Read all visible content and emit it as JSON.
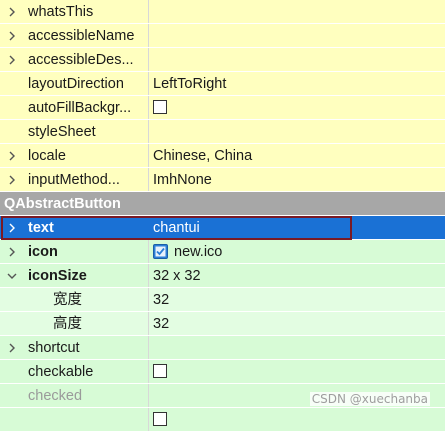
{
  "colors": {
    "row_yellow": "#ffffbf",
    "row_green": "#d7fbd6",
    "section_header": "#a7a7a7",
    "selection": "#1a71d5",
    "focus_border": "#7a1a25"
  },
  "properties_top": [
    {
      "name": "whatsThis",
      "value": "",
      "expandable": true
    },
    {
      "name": "accessibleName",
      "value": "",
      "expandable": true
    },
    {
      "name": "accessibleDes...",
      "value": "",
      "expandable": true
    },
    {
      "name": "layoutDirection",
      "value": "LeftToRight",
      "expandable": false
    },
    {
      "name": "autoFillBackgr...",
      "value": "",
      "checkbox": true,
      "expandable": false
    },
    {
      "name": "styleSheet",
      "value": "",
      "expandable": false
    },
    {
      "name": "locale",
      "value": "Chinese, China",
      "expandable": true
    },
    {
      "name": "inputMethod...",
      "value": "ImhNone",
      "expandable": true
    }
  ],
  "section": {
    "title": "QAbstractButton"
  },
  "text_row": {
    "name": "text",
    "value": "chantui"
  },
  "icon_row": {
    "name": "icon",
    "value": "new.ico",
    "icon": "check-image-icon"
  },
  "iconsize_row": {
    "name": "iconSize",
    "value": "32 x 32"
  },
  "width_row": {
    "name": "宽度",
    "value": "32"
  },
  "height_row": {
    "name": "高度",
    "value": "32"
  },
  "shortcut_row": {
    "name": "shortcut",
    "value": ""
  },
  "checkable_row": {
    "name": "checkable",
    "value": ""
  },
  "checked_row": {
    "name": "checked",
    "value": ""
  },
  "watermark": "CSDN @xuechanba"
}
